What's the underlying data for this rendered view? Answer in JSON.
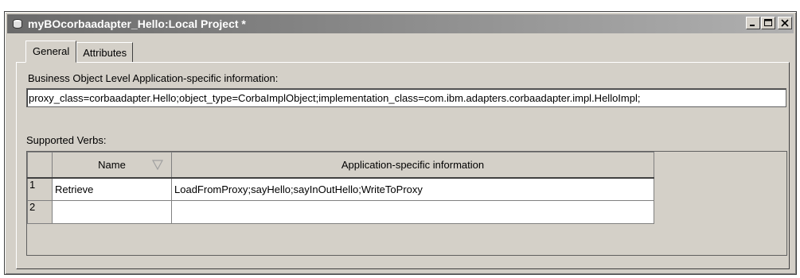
{
  "window": {
    "title": "myBOcorbaadapter_Hello:Local Project *",
    "icon": "database-icon"
  },
  "tabs": [
    {
      "label": "General",
      "active": true
    },
    {
      "label": "Attributes",
      "active": false
    }
  ],
  "general": {
    "bo_label": "Business Object Level Application-specific information:",
    "bo_value": "proxy_class=corbaadapter.Hello;object_type=CorbaImplObject;implementation_class=com.ibm.adapters.corbaadapter.impl.HelloImpl;",
    "verbs_label": "Supported Verbs:"
  },
  "verbs_table": {
    "columns": [
      "Name",
      "Application-specific information"
    ],
    "rows": [
      {
        "num": "1",
        "name": "Retrieve",
        "info": "LoadFromProxy;sayHello;sayInOutHello;WriteToProxy"
      },
      {
        "num": "2",
        "name": "",
        "info": ""
      }
    ]
  }
}
